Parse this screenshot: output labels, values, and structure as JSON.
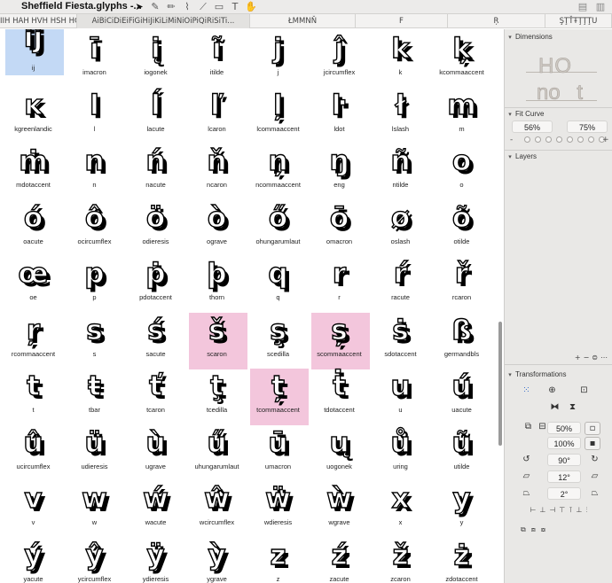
{
  "window": {
    "title": "Sheffield Fiesta.glyphs -..."
  },
  "toolbar": {
    "tools": [
      {
        "icon": "select-arrow-icon",
        "glyph": "➤"
      },
      {
        "icon": "draw-icon",
        "glyph": "✎"
      },
      {
        "icon": "pencil-icon",
        "glyph": "✏"
      },
      {
        "icon": "brush-icon",
        "glyph": "⌇"
      },
      {
        "icon": "knife-icon",
        "glyph": "⟋"
      },
      {
        "icon": "rectangle-icon",
        "glyph": "▭"
      },
      {
        "icon": "text-icon",
        "glyph": "T"
      },
      {
        "icon": "hand-icon",
        "glyph": "✋"
      }
    ],
    "window_controls": [
      {
        "icon": "sidebar-icon",
        "glyph": "▤"
      },
      {
        "icon": "panel-icon",
        "glyph": "▥"
      }
    ]
  },
  "tabs": [
    "IIH HAH HVH HSH HCH HBH H...",
    "AiBiCiDiEiFiGiHiJiKiLiMiNiOiPiQiRiSiTi...",
    "ŁMMNŇ",
    "F",
    "Ŗ",
    "ŞŢŤŦŢŢŢU"
  ],
  "glyphs": [
    {
      "name": "ij",
      "char": "ĳ",
      "state": "blue"
    },
    {
      "name": "imacron",
      "char": "ī",
      "state": ""
    },
    {
      "name": "iogonek",
      "char": "į",
      "state": ""
    },
    {
      "name": "itilde",
      "char": "ĩ",
      "state": ""
    },
    {
      "name": "j",
      "char": "j",
      "state": ""
    },
    {
      "name": "jcircumflex",
      "char": "ĵ",
      "state": ""
    },
    {
      "name": "k",
      "char": "k",
      "state": ""
    },
    {
      "name": "kcommaaccent",
      "char": "ķ",
      "state": ""
    },
    {
      "name": "kgreenlandic",
      "char": "ĸ",
      "state": ""
    },
    {
      "name": "l",
      "char": "l",
      "state": ""
    },
    {
      "name": "lacute",
      "char": "ĺ",
      "state": ""
    },
    {
      "name": "lcaron",
      "char": "ľ",
      "state": ""
    },
    {
      "name": "lcommaaccent",
      "char": "ļ",
      "state": ""
    },
    {
      "name": "ldot",
      "char": "ŀ",
      "state": ""
    },
    {
      "name": "lslash",
      "char": "ł",
      "state": ""
    },
    {
      "name": "m",
      "char": "m",
      "state": ""
    },
    {
      "name": "mdotaccent",
      "char": "ṁ",
      "state": ""
    },
    {
      "name": "n",
      "char": "n",
      "state": ""
    },
    {
      "name": "nacute",
      "char": "ń",
      "state": ""
    },
    {
      "name": "ncaron",
      "char": "ň",
      "state": ""
    },
    {
      "name": "ncommaaccent",
      "char": "ņ",
      "state": ""
    },
    {
      "name": "eng",
      "char": "ŋ",
      "state": ""
    },
    {
      "name": "ntilde",
      "char": "ñ",
      "state": ""
    },
    {
      "name": "o",
      "char": "o",
      "state": ""
    },
    {
      "name": "oacute",
      "char": "ó",
      "state": ""
    },
    {
      "name": "ocircumflex",
      "char": "ô",
      "state": ""
    },
    {
      "name": "odieresis",
      "char": "ö",
      "state": ""
    },
    {
      "name": "ograve",
      "char": "ò",
      "state": ""
    },
    {
      "name": "ohungarumlaut",
      "char": "ő",
      "state": ""
    },
    {
      "name": "omacron",
      "char": "ō",
      "state": ""
    },
    {
      "name": "oslash",
      "char": "ø",
      "state": ""
    },
    {
      "name": "otilde",
      "char": "õ",
      "state": ""
    },
    {
      "name": "oe",
      "char": "œ",
      "state": ""
    },
    {
      "name": "p",
      "char": "p",
      "state": ""
    },
    {
      "name": "pdotaccent",
      "char": "ṗ",
      "state": ""
    },
    {
      "name": "thorn",
      "char": "þ",
      "state": ""
    },
    {
      "name": "q",
      "char": "q",
      "state": ""
    },
    {
      "name": "r",
      "char": "r",
      "state": ""
    },
    {
      "name": "racute",
      "char": "ŕ",
      "state": ""
    },
    {
      "name": "rcaron",
      "char": "ř",
      "state": ""
    },
    {
      "name": "rcommaaccent",
      "char": "ŗ",
      "state": ""
    },
    {
      "name": "s",
      "char": "s",
      "state": ""
    },
    {
      "name": "sacute",
      "char": "ś",
      "state": ""
    },
    {
      "name": "scaron",
      "char": "š",
      "state": "pink"
    },
    {
      "name": "scedilla",
      "char": "ş",
      "state": ""
    },
    {
      "name": "scommaaccent",
      "char": "ș",
      "state": "pink"
    },
    {
      "name": "sdotaccent",
      "char": "ṡ",
      "state": ""
    },
    {
      "name": "germandbls",
      "char": "ß",
      "state": ""
    },
    {
      "name": "t",
      "char": "t",
      "state": ""
    },
    {
      "name": "tbar",
      "char": "ŧ",
      "state": ""
    },
    {
      "name": "tcaron",
      "char": "ť",
      "state": ""
    },
    {
      "name": "tcedilla",
      "char": "ţ",
      "state": ""
    },
    {
      "name": "tcommaaccent",
      "char": "ț",
      "state": "pink"
    },
    {
      "name": "tdotaccent",
      "char": "ṫ",
      "state": ""
    },
    {
      "name": "u",
      "char": "u",
      "state": ""
    },
    {
      "name": "uacute",
      "char": "ú",
      "state": ""
    },
    {
      "name": "ucircumflex",
      "char": "û",
      "state": ""
    },
    {
      "name": "udieresis",
      "char": "ü",
      "state": ""
    },
    {
      "name": "ugrave",
      "char": "ù",
      "state": ""
    },
    {
      "name": "uhungarumlaut",
      "char": "ű",
      "state": ""
    },
    {
      "name": "umacron",
      "char": "ū",
      "state": ""
    },
    {
      "name": "uogonek",
      "char": "ų",
      "state": ""
    },
    {
      "name": "uring",
      "char": "ů",
      "state": ""
    },
    {
      "name": "utilde",
      "char": "ũ",
      "state": ""
    },
    {
      "name": "v",
      "char": "v",
      "state": ""
    },
    {
      "name": "w",
      "char": "w",
      "state": ""
    },
    {
      "name": "wacute",
      "char": "ẃ",
      "state": ""
    },
    {
      "name": "wcircumflex",
      "char": "ŵ",
      "state": ""
    },
    {
      "name": "wdieresis",
      "char": "ẅ",
      "state": ""
    },
    {
      "name": "wgrave",
      "char": "ẁ",
      "state": ""
    },
    {
      "name": "x",
      "char": "x",
      "state": ""
    },
    {
      "name": "y",
      "char": "y",
      "state": ""
    },
    {
      "name": "yacute",
      "char": "ý",
      "state": ""
    },
    {
      "name": "ycircumflex",
      "char": "ŷ",
      "state": ""
    },
    {
      "name": "ydieresis",
      "char": "ÿ",
      "state": ""
    },
    {
      "name": "ygrave",
      "char": "ỳ",
      "state": ""
    },
    {
      "name": "z",
      "char": "z",
      "state": ""
    },
    {
      "name": "zacute",
      "char": "ź",
      "state": ""
    },
    {
      "name": "zcaron",
      "char": "ž",
      "state": ""
    },
    {
      "name": "zdotaccent",
      "char": "ż",
      "state": ""
    }
  ],
  "colors": {
    "selection_blue": "#c3d9f5",
    "selection_pink": "#f3c6dc",
    "sidebar_bg": "#e9e8e6"
  },
  "inspector": {
    "dimensions": {
      "title": "Dimensions",
      "preview_top": "HO",
      "preview_bottom": "no t"
    },
    "fit_curve": {
      "title": "Fit Curve",
      "value_left": "56%",
      "value_right": "75%",
      "minus": "-",
      "plus": "+",
      "dot_count": 8
    },
    "layers": {
      "title": "Layers"
    },
    "transformations": {
      "title": "Transformations",
      "scale_x": "50%",
      "scale_y": "100%",
      "rotate": "90°",
      "slant": "12°",
      "skew": "2°"
    }
  }
}
